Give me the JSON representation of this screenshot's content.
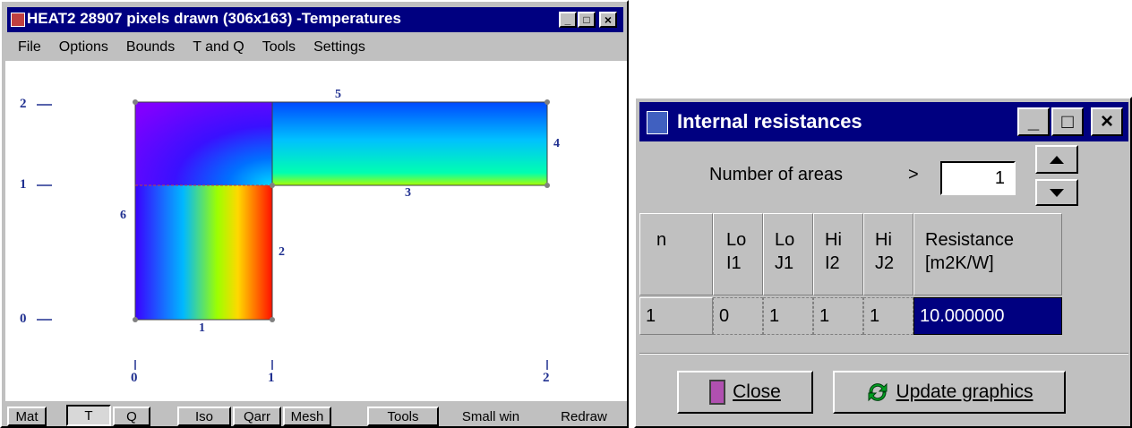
{
  "heat_window": {
    "title": "HEAT2 28907 pixels drawn (306x163) -Temperatures",
    "controls": {
      "minimize": "_",
      "maximize": "□",
      "close": "×"
    },
    "menu": [
      "File",
      "Options",
      "Bounds",
      "T and Q",
      "Tools",
      "Settings"
    ],
    "axes": {
      "y_labels": [
        "2",
        "1",
        "0"
      ],
      "x_labels": [
        "0",
        "1",
        "2"
      ]
    },
    "boundaries": [
      "1",
      "2",
      "3",
      "4",
      "5",
      "6"
    ],
    "toolbar": {
      "mat": "Mat",
      "t": "T",
      "q": "Q",
      "iso": "Iso",
      "qarr": "Qarr",
      "mesh": "Mesh",
      "tools": "Tools",
      "small_win": "Small win",
      "redraw": "Redraw"
    }
  },
  "resist_window": {
    "title": "Internal resistances",
    "controls": {
      "minimize": "_",
      "maximize": "□",
      "close": "×"
    },
    "areas_label": "Number of areas",
    "arrow": ">",
    "areas_value": "1",
    "table": {
      "headers": [
        "n",
        "Lo\nI1",
        "Lo\nJ1",
        "Hi\nI2",
        "Hi\nJ2",
        "Resistance\n[m2K/W]"
      ],
      "rows": [
        [
          "1",
          "0",
          "1",
          "1",
          "1",
          "10.000000"
        ]
      ]
    },
    "close_label": "Close",
    "update_label": "Update graphics"
  },
  "colors": {
    "title_bar": "#000080",
    "face": "#c0c0c0",
    "selected_cell": "#000080"
  }
}
